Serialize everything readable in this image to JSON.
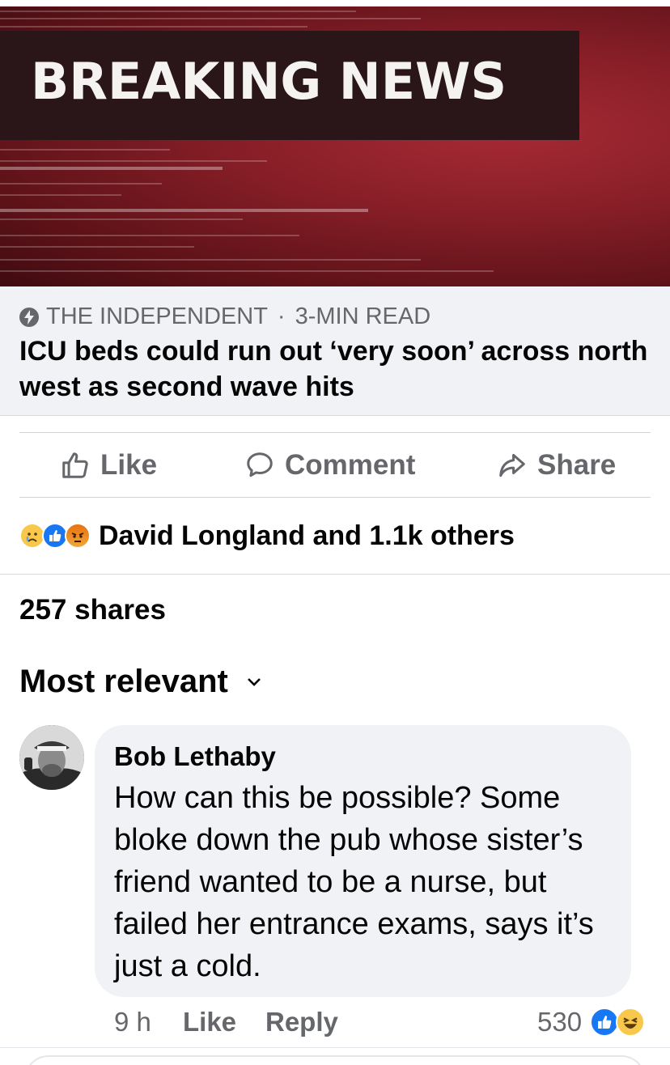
{
  "hero": {
    "banner_text": "BREAKING NEWS"
  },
  "preview": {
    "source": "THE INDEPENDENT",
    "separator": "·",
    "read_time": "3-MIN READ",
    "headline": "ICU beds could run out ‘very soon’ across north west as second wave hits"
  },
  "actions": {
    "like": "Like",
    "comment": "Comment",
    "share": "Share"
  },
  "reactions": {
    "icons": [
      "sad-face",
      "thumbs-up",
      "angry-face"
    ],
    "names": "David Longland and 1.1k others"
  },
  "shares": "257 shares",
  "sort": {
    "label": "Most relevant"
  },
  "comment": {
    "author": "Bob Lethaby",
    "text": "How can this be possible? Some bloke down the pub whose sister’s friend wanted to be a nurse, but failed her entrance exams, says it’s just a cold.",
    "time": "9 h",
    "like": "Like",
    "reply": "Reply",
    "reaction_count": "530",
    "reaction_icons": [
      "thumbs-up",
      "laughing-face"
    ]
  },
  "colors": {
    "accent": "#1877f2",
    "muted": "#65676b",
    "banner_red": "#8a1f28"
  }
}
